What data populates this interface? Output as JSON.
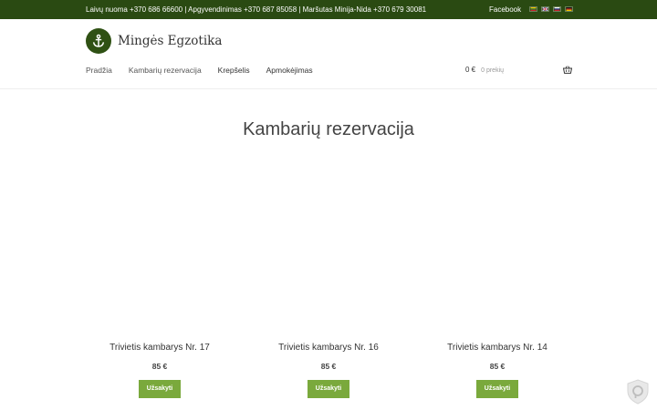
{
  "topbar": {
    "contact": "Laivų nuoma +370 686 66600 | Apgyvendinimas +370 687 85058 | Maršutas Minija-Nida +370 679 30081",
    "facebook": "Facebook",
    "flags": [
      {
        "name": "flag-lt-icon",
        "colors": [
          "#f5c400",
          "#2a8a3a",
          "#c8202a"
        ]
      },
      {
        "name": "flag-en-icon",
        "colors": [
          "#1e3a8a",
          "#ffffff",
          "#c8202a"
        ]
      },
      {
        "name": "flag-ru-icon",
        "colors": [
          "#ffffff",
          "#1e3a8a",
          "#c8202a"
        ]
      },
      {
        "name": "flag-de-icon",
        "colors": [
          "#111111",
          "#c8202a",
          "#f5c400"
        ]
      }
    ],
    "background": "#2a4a12"
  },
  "header": {
    "logo_icon": "anchor-icon",
    "site_title": "Mingės Egzotika"
  },
  "nav": {
    "items": [
      {
        "label": "Pradžia"
      },
      {
        "label": "Kambarių rezervacija"
      },
      {
        "label": "Krepšelis"
      },
      {
        "label": "Apmokėjimas"
      }
    ]
  },
  "cart": {
    "total": "0 €",
    "count": "0 prekių",
    "icon": "basket-icon"
  },
  "main": {
    "page_title": "Kambarių rezervacija",
    "products": [
      {
        "name": "Trivietis kambarys Nr. 17",
        "price": "85 €",
        "button": "Užsakyti"
      },
      {
        "name": "Trivietis kambarys Nr. 16",
        "price": "85 €",
        "button": "Užsakyti"
      },
      {
        "name": "Trivietis kambarys Nr. 14",
        "price": "85 €",
        "button": "Užsakyti"
      }
    ],
    "button_color": "#7aa93c"
  },
  "badge": {
    "icon": "privacy-shield-icon"
  }
}
